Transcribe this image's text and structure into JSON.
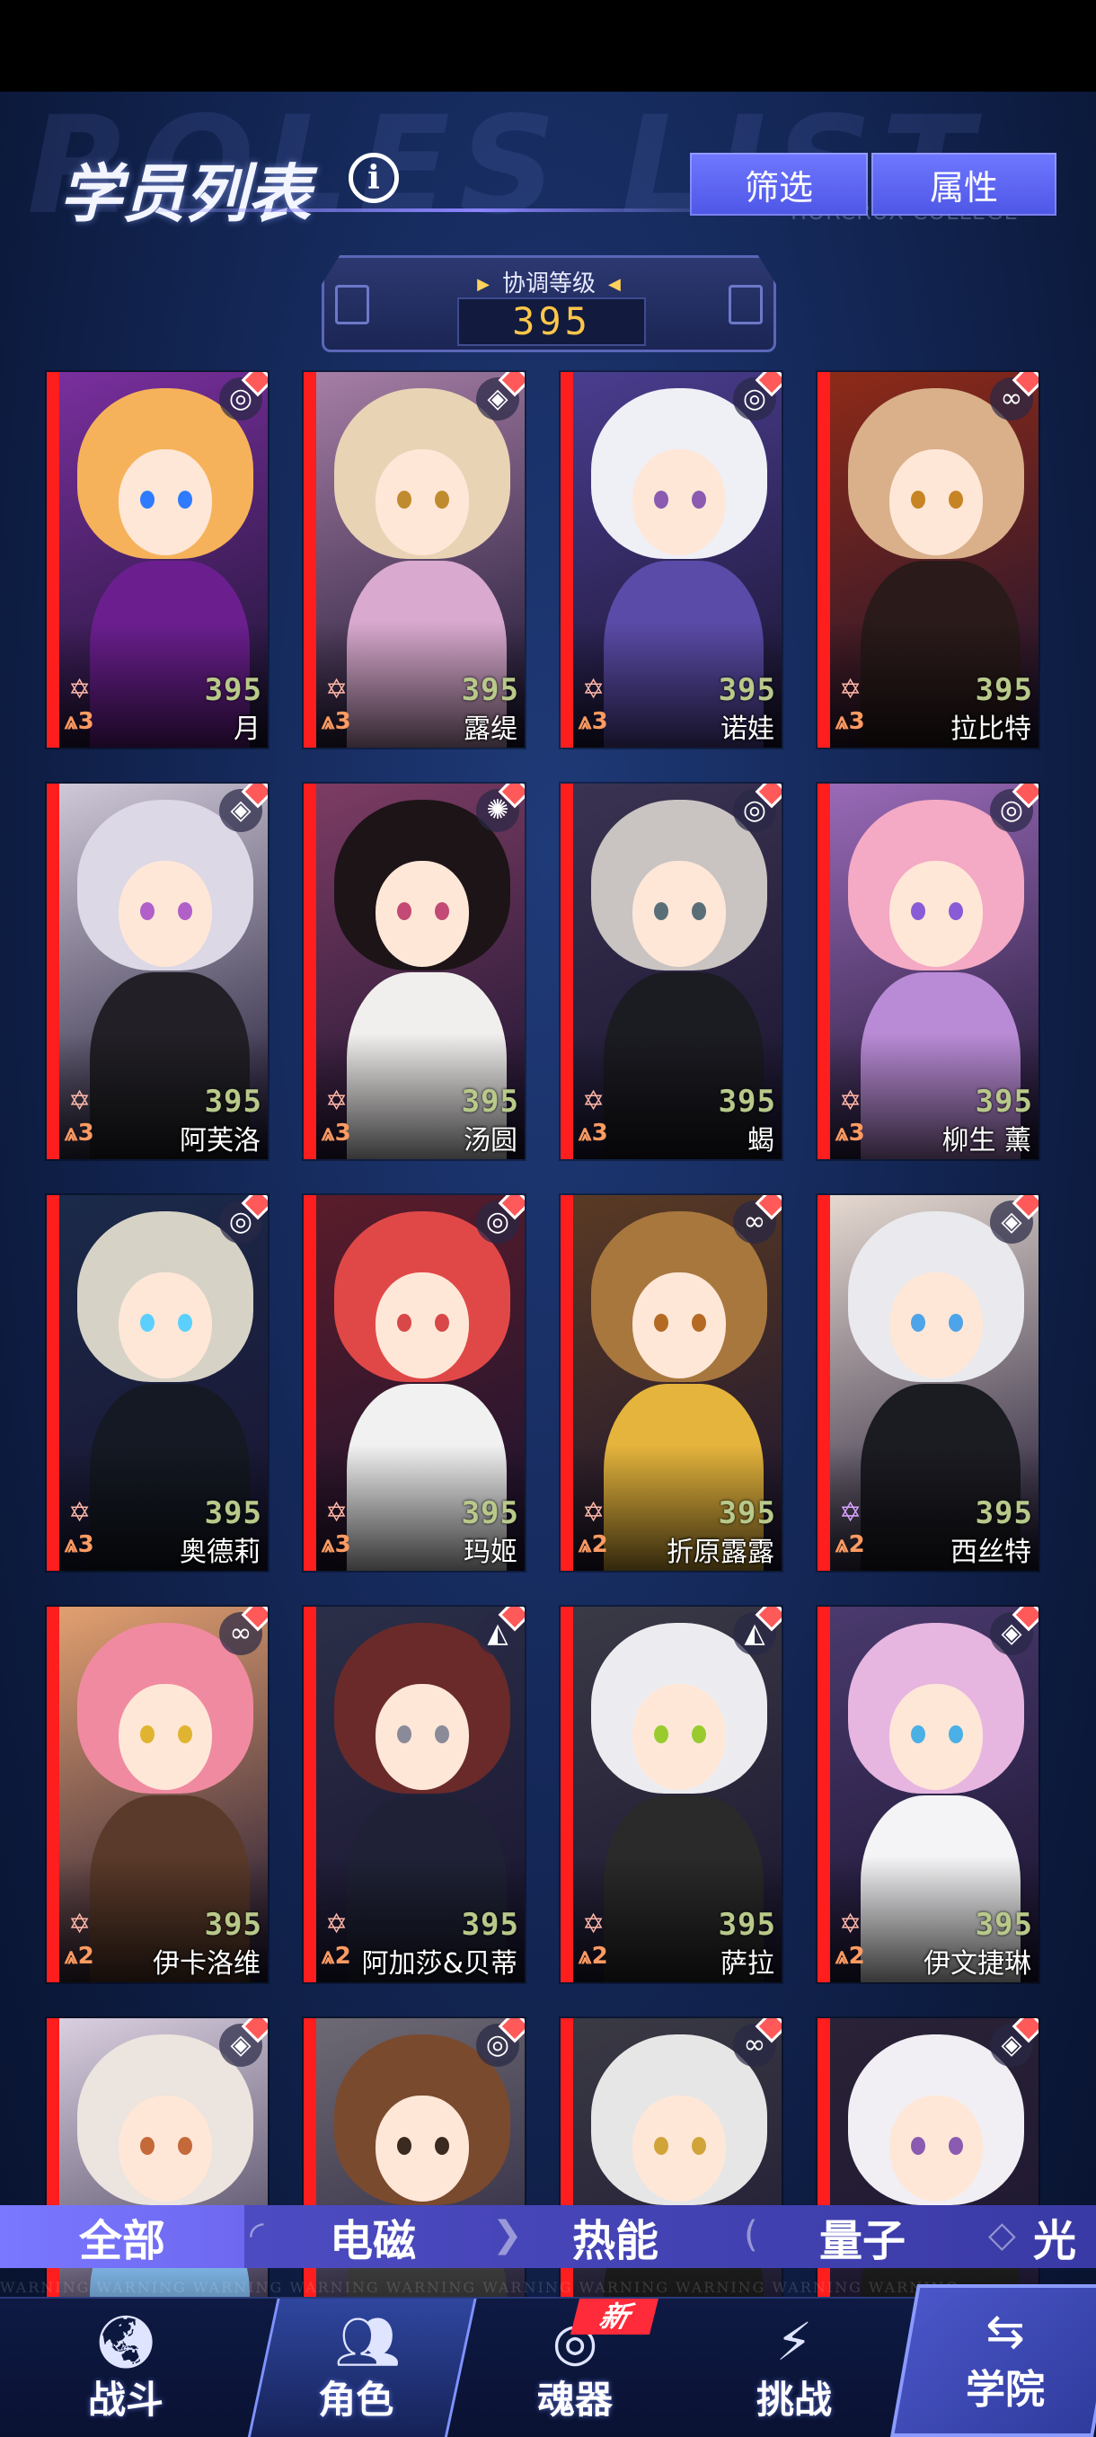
{
  "header": {
    "title": "学员列表",
    "watermark": "ROLES LIST",
    "subtitle": "HORCRUX COLLEGE",
    "info_symbol": "i",
    "filter_button": "筛选",
    "attribute_button": "属性"
  },
  "coordination": {
    "label": "协调等级",
    "value": "395"
  },
  "cards": [
    {
      "name": "月",
      "level": "395",
      "stars": "3",
      "attribute_icon": "magnetic-icon",
      "bg": "#7a2f9e",
      "hair": "#f6b25a",
      "outfit": "#6b1f8f",
      "eye": "#2f7bff"
    },
    {
      "name": "露缇",
      "level": "395",
      "stars": "3",
      "attribute_icon": "quantum-icon",
      "bg": "#a67ea5",
      "hair": "#e9d3b5",
      "outfit": "#d9a9cf",
      "eye": "#c08b2e"
    },
    {
      "name": "诺娃",
      "level": "395",
      "stars": "3",
      "attribute_icon": "magnetic-icon",
      "bg": "#4a3d8f",
      "hair": "#efeff6",
      "outfit": "#5b4ba8",
      "eye": "#8a5bb0"
    },
    {
      "name": "拉比特",
      "level": "395",
      "stars": "3",
      "attribute_icon": "thermal-icon",
      "bg": "#8e2a18",
      "hair": "#d9b08a",
      "outfit": "#2a1a1a",
      "eye": "#c78422"
    },
    {
      "name": "阿芙洛",
      "level": "395",
      "stars": "3",
      "attribute_icon": "quantum-icon",
      "bg": "#cfc8d8",
      "hair": "#dcd8e6",
      "outfit": "#222026",
      "eye": "#b060c8"
    },
    {
      "name": "汤圆",
      "level": "395",
      "stars": "3",
      "attribute_icon": "light-icon",
      "bg": "#7d3c64",
      "hair": "#1d1418",
      "outfit": "#f1efee",
      "eye": "#c24a74"
    },
    {
      "name": "蝎",
      "level": "395",
      "stars": "3",
      "attribute_icon": "magnetic-icon",
      "bg": "#3a3452",
      "hair": "#c9c4c2",
      "outfit": "#1b1b22",
      "eye": "#5a6e78"
    },
    {
      "name": "柳生 薰",
      "level": "395",
      "stars": "3",
      "attribute_icon": "magnetic-icon",
      "bg": "#9a6ab8",
      "hair": "#f4a9c4",
      "outfit": "#b98bd6",
      "eye": "#8a5bd6"
    },
    {
      "name": "奥德莉",
      "level": "395",
      "stars": "3",
      "attribute_icon": "magnetic-icon",
      "bg": "#1b2a4a",
      "hair": "#d6d2c6",
      "outfit": "#141923",
      "eye": "#5bd0ff"
    },
    {
      "name": "玛姬",
      "level": "395",
      "stars": "3",
      "attribute_icon": "magnetic-icon",
      "bg": "#5a1c2a",
      "hair": "#e04848",
      "outfit": "#f1f1f1",
      "eye": "#d84848"
    },
    {
      "name": "折原露露",
      "level": "395",
      "stars": "2",
      "attribute_icon": "thermal-icon",
      "bg": "#5a3a24",
      "hair": "#a8773e",
      "outfit": "#e5b43c",
      "eye": "#b56a24"
    },
    {
      "name": "西丝特",
      "level": "395",
      "stars": "2",
      "attribute_icon": "quantum-icon",
      "bg": "#e5d9d0",
      "hair": "#e9e9ee",
      "outfit": "#1b1b22",
      "eye": "#4ea4e8"
    },
    {
      "name": "伊卡洛维",
      "level": "395",
      "stars": "2",
      "attribute_icon": "thermal-icon",
      "bg": "#e2a070",
      "hair": "#f08aa0",
      "outfit": "#5a3a2a",
      "eye": "#e0b430"
    },
    {
      "name": "阿加莎&贝蒂",
      "level": "395",
      "stars": "2",
      "attribute_icon": "electro-icon",
      "bg": "#2b2f48",
      "hair": "#6a2a2a",
      "outfit": "#1f2236",
      "eye": "#8a8a98"
    },
    {
      "name": "萨拉",
      "level": "395",
      "stars": "2",
      "attribute_icon": "electro-icon",
      "bg": "#3a3a46",
      "hair": "#ececf0",
      "outfit": "#2a2a2a",
      "eye": "#9acb2e"
    },
    {
      "name": "伊文捷琳",
      "level": "395",
      "stars": "2",
      "attribute_icon": "quantum-icon",
      "bg": "#4a3a6e",
      "hair": "#e6b6e0",
      "outfit": "#f4f4f6",
      "eye": "#4ab0e6"
    },
    {
      "name": "",
      "level": "",
      "stars": "",
      "attribute_icon": "quantum-icon",
      "bg": "#d9cfe0",
      "hair": "#ece4de",
      "outfit": "#7bb0e0",
      "eye": "#c46a3a"
    },
    {
      "name": "",
      "level": "",
      "stars": "",
      "attribute_icon": "magnetic-icon",
      "bg": "#6e6a74",
      "hair": "#7a4a2e",
      "outfit": "#3a3a3a",
      "eye": "#3a2a20"
    },
    {
      "name": "",
      "level": "",
      "stars": "",
      "attribute_icon": "thermal-icon",
      "bg": "#3a3a44",
      "hair": "#e6e6e6",
      "outfit": "#1b1b1b",
      "eye": "#d1a43a"
    },
    {
      "name": "",
      "level": "",
      "stars": "",
      "attribute_icon": "quantum-icon",
      "bg": "#2a2236",
      "hair": "#f1eef4",
      "outfit": "#1b1b1b",
      "eye": "#8a5bb0"
    }
  ],
  "filters": [
    {
      "label": "全部",
      "active": true
    },
    {
      "label": "电磁",
      "active": false
    },
    {
      "label": "热能",
      "active": false
    },
    {
      "label": "量子",
      "active": false
    },
    {
      "label": "光",
      "active": false
    }
  ],
  "warning_text": "WARNING   WARNING   WARNING   WARNING   WARNING   WARNING   WARNING   WARNING   WARNING   WARNING",
  "bottom_nav": {
    "battle": "战斗",
    "characters": "角色",
    "souls": "魂器",
    "souls_badge": "新",
    "challenge": "挑战",
    "academy": "学院"
  },
  "colors": {
    "accent": "#6f78ff",
    "card_edge": "#ff1e1e",
    "level_text": "#b8c98a",
    "coord_value": "#ffc64a",
    "star_color": "#ff9b62"
  }
}
